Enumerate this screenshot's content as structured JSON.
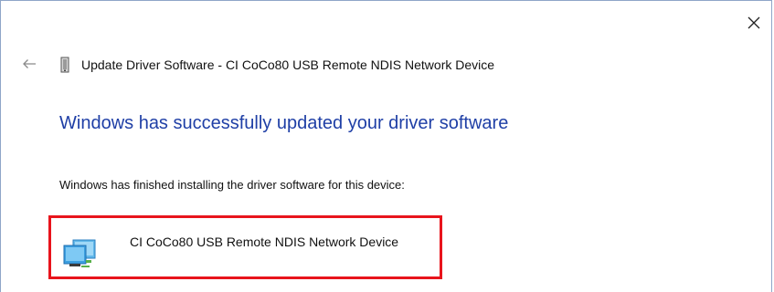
{
  "dialog": {
    "header_title": "Update Driver Software - CI CoCo80 USB Remote NDIS Network Device",
    "heading": "Windows has successfully updated your driver software",
    "message": "Windows has finished installing the driver software for this device:",
    "device_name": "CI CoCo80 USB Remote NDIS Network Device"
  },
  "icons": {
    "close": "close-icon",
    "back": "back-arrow-icon",
    "header": "device-manager-icon",
    "device": "network-adapter-icon"
  },
  "colors": {
    "heading": "#1f3fa6",
    "highlight_border": "#e8141c",
    "window_border": "#8fa6c8"
  }
}
